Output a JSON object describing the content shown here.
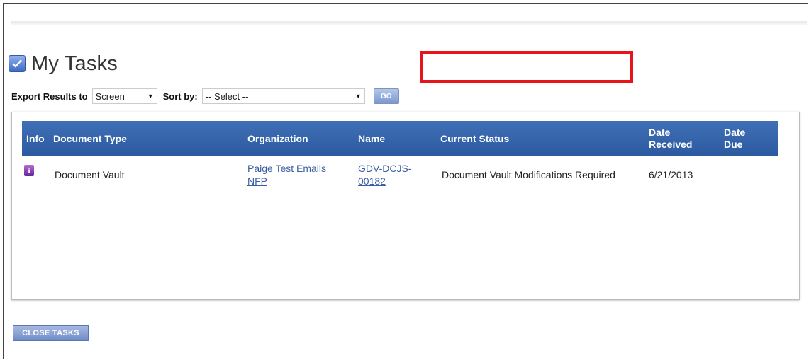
{
  "page": {
    "title": "My Tasks"
  },
  "controls": {
    "export_label": "Export Results to",
    "export_value": "Screen",
    "sort_label": "Sort by:",
    "sort_value": "-- Select --",
    "go_label": "GO"
  },
  "table": {
    "headers": {
      "info": "Info",
      "document_type": "Document Type",
      "organization": "Organization",
      "name": "Name",
      "current_status": "Current Status",
      "date_received_1": "Date",
      "date_received_2": "Received",
      "date_due_1": "Date",
      "date_due_2": "Due"
    },
    "rows": [
      {
        "info_icon": "info-icon",
        "document_type": "Document Vault",
        "organization_1": "Paige Test Emails",
        "organization_2": "NFP",
        "name_1": "GDV-DCJS-",
        "name_2": "00182",
        "current_status": "Document Vault Modifications Required",
        "date_received": "6/21/2013",
        "date_due": ""
      }
    ]
  },
  "footer": {
    "close_label": "CLOSE TASKS"
  },
  "colors": {
    "header_bg": "#2c5aa0",
    "highlight": "#e8141b",
    "link": "#3b5ea0"
  }
}
